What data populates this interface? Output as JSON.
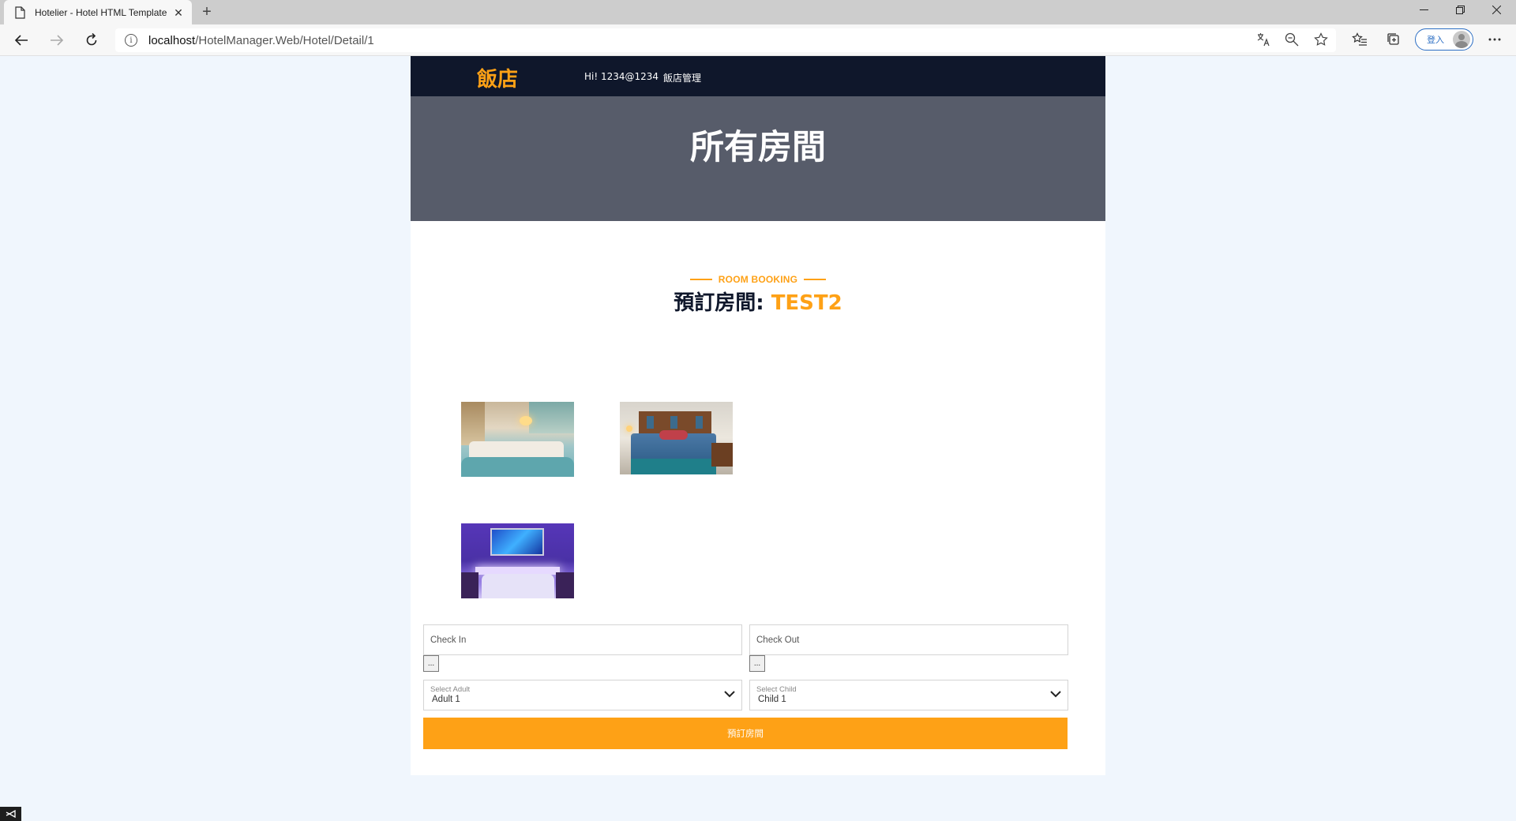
{
  "browser": {
    "tab_title": "Hotelier - Hotel HTML Template",
    "url_host": "localhost",
    "url_path": "/HotelManager.Web/Hotel/Detail/1",
    "profile_label": "登入"
  },
  "navbar": {
    "brand": "飯店",
    "user_greeting": "Hi! 1234@1234",
    "manage_link": "飯店管理"
  },
  "hero": {
    "title": "所有房間"
  },
  "booking": {
    "subtitle": "ROOM BOOKING",
    "title_prefix": "預訂房間: ",
    "room_name": "TEST2",
    "check_in_label": "Check In",
    "check_out_label": "Check Out",
    "picker_label": "...",
    "adult": {
      "label": "Select Adult",
      "value": "Adult 1"
    },
    "child": {
      "label": "Select Child",
      "value": "Child 1"
    },
    "submit_label": "預訂房間"
  },
  "colors": {
    "primary": "#fea116",
    "navbar_bg": "#0f172b",
    "hero_bg": "#575c6a",
    "page_bg": "#f0f6fd"
  },
  "images": [
    "room-photo-1",
    "room-photo-2",
    "room-photo-3"
  ]
}
